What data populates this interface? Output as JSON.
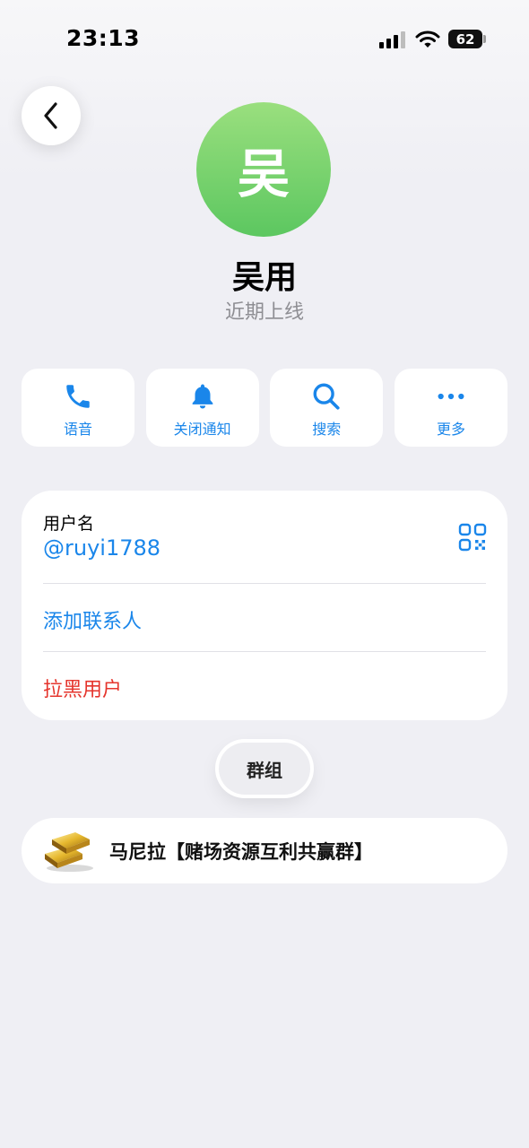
{
  "status_bar": {
    "time": "23:13",
    "battery": "62"
  },
  "profile": {
    "avatar_text": "吴",
    "name": "吴用",
    "presence": "近期上线"
  },
  "actions": [
    {
      "label": "语音",
      "icon": "phone-icon"
    },
    {
      "label": "关闭通知",
      "icon": "bell-icon"
    },
    {
      "label": "搜索",
      "icon": "search-icon"
    },
    {
      "label": "更多",
      "icon": "more-icon"
    }
  ],
  "info": {
    "username_label": "用户名",
    "username_value": "@ruyi1788",
    "add_contact": "添加联系人",
    "block_user": "拉黑用户"
  },
  "groups_tab": {
    "label": "群组"
  },
  "groups": [
    {
      "name": "马尼拉【赌场资源互利共赢群】",
      "icon": "gold-bars-icon"
    }
  ],
  "colors": {
    "accent": "#1A86EA",
    "danger": "#E5342C",
    "avatar_green": "#5CC760",
    "background": "#EFEFF4"
  }
}
